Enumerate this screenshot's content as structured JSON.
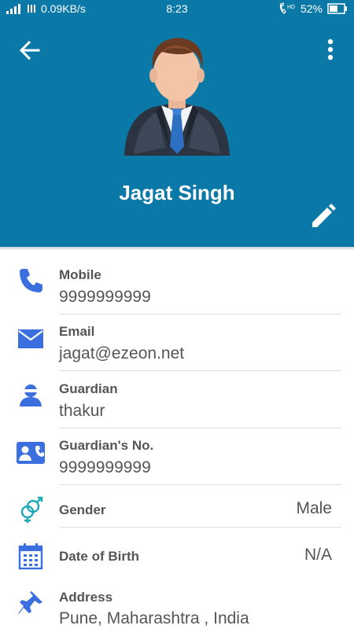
{
  "statusbar": {
    "speed": "0.09KB/s",
    "time": "8:23",
    "hd": "HD",
    "battery": "52%"
  },
  "header": {
    "name": "Jagat Singh",
    "background": "#0b79a8"
  },
  "rows": [
    {
      "label": "Mobile",
      "value": "9999999999",
      "icon": "phone-icon"
    },
    {
      "label": "Email",
      "value": "jagat@ezeon.net",
      "icon": "email-icon"
    },
    {
      "label": "Guardian",
      "value": "thakur",
      "icon": "person-icon"
    },
    {
      "label": "Guardian's No.",
      "value": "9999999999",
      "icon": "contact-phone-icon"
    },
    {
      "label": "Gender",
      "value": "Male",
      "icon": "gender-icon"
    },
    {
      "label": "Date of Birth",
      "value": "N/A",
      "icon": "calendar-icon"
    },
    {
      "label": "Address",
      "value": "Pune, Maharashtra , India",
      "icon": "pin-icon"
    }
  ],
  "colors": {
    "accent": "#3b6fe0",
    "gender_icon": "#1ea7b5",
    "text": "#555555"
  }
}
